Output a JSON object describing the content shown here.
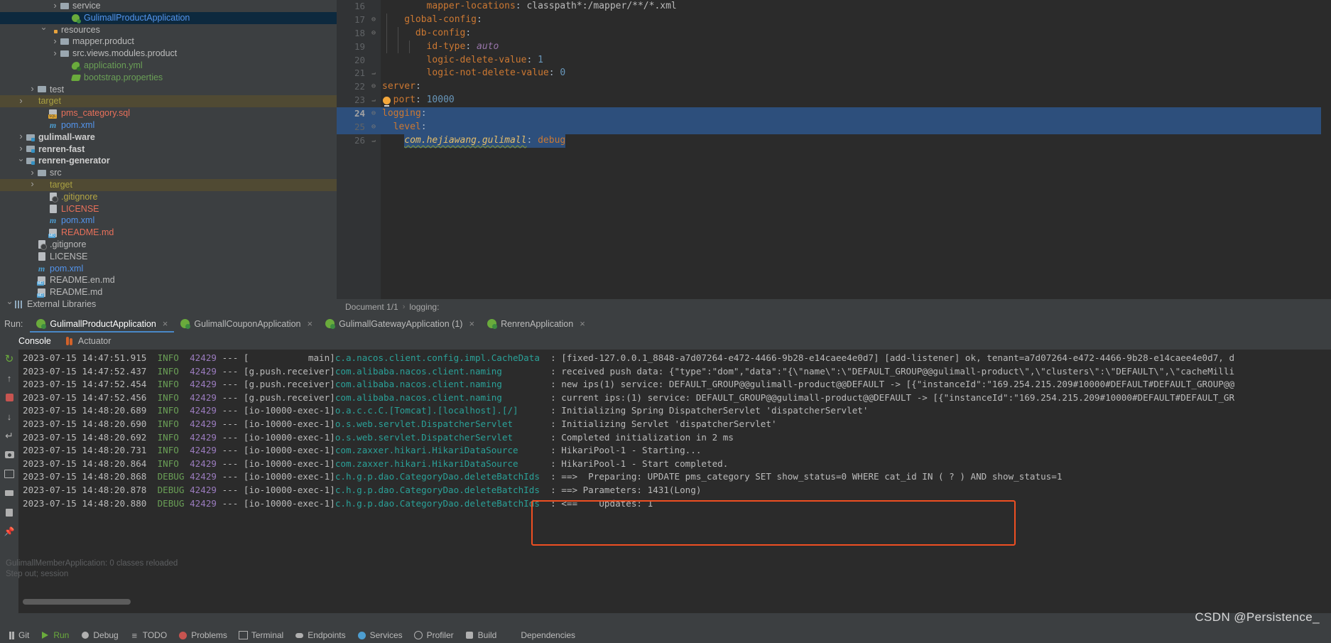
{
  "project_tree": [
    {
      "indent": 4,
      "arrow": "right",
      "icon": "folder",
      "label": "service",
      "color": "c-default",
      "state": "normal"
    },
    {
      "indent": 5,
      "arrow": "none",
      "icon": "spring",
      "label": "GulimallProductApplication",
      "color": "c-sel",
      "state": "selected"
    },
    {
      "indent": 3,
      "arrow": "down",
      "icon": "folder-res",
      "label": "resources",
      "color": "c-default",
      "state": "normal"
    },
    {
      "indent": 4,
      "arrow": "right",
      "icon": "folder",
      "label": "mapper.product",
      "color": "c-default",
      "state": "normal"
    },
    {
      "indent": 4,
      "arrow": "right",
      "icon": "folder",
      "label": "src.views.modules.product",
      "color": "c-default",
      "state": "normal"
    },
    {
      "indent": 5,
      "arrow": "none",
      "icon": "yml",
      "label": "application.yml",
      "color": "c-green",
      "state": "normal"
    },
    {
      "indent": 5,
      "arrow": "none",
      "icon": "props",
      "label": "bootstrap.properties",
      "color": "c-green",
      "state": "normal"
    },
    {
      "indent": 2,
      "arrow": "right",
      "icon": "folder",
      "label": "test",
      "color": "c-default",
      "state": "normal"
    },
    {
      "indent": 1,
      "arrow": "right",
      "icon": "folder-orange",
      "label": "target",
      "color": "c-olive",
      "state": "target"
    },
    {
      "indent": 3,
      "arrow": "none",
      "icon": "sql",
      "label": "pms_category.sql",
      "color": "c-red",
      "state": "normal"
    },
    {
      "indent": 3,
      "arrow": "none",
      "icon": "xml-m",
      "label": "pom.xml",
      "color": "c-blue",
      "state": "normal"
    },
    {
      "indent": 1,
      "arrow": "right",
      "icon": "module",
      "label": "gulimall-ware",
      "color": "bold",
      "state": "normal"
    },
    {
      "indent": 1,
      "arrow": "right",
      "icon": "module",
      "label": "renren-fast",
      "color": "bold",
      "state": "normal"
    },
    {
      "indent": 1,
      "arrow": "down",
      "icon": "module",
      "label": "renren-generator",
      "color": "bold",
      "state": "normal"
    },
    {
      "indent": 2,
      "arrow": "right",
      "icon": "folder",
      "label": "src",
      "color": "c-default",
      "state": "normal"
    },
    {
      "indent": 2,
      "arrow": "right",
      "icon": "folder-orange",
      "label": "target",
      "color": "c-olive",
      "state": "target"
    },
    {
      "indent": 3,
      "arrow": "none",
      "icon": "gitignore",
      "label": ".gitignore",
      "color": "c-yellow",
      "state": "normal"
    },
    {
      "indent": 3,
      "arrow": "none",
      "icon": "license",
      "label": "LICENSE",
      "color": "c-red",
      "state": "normal"
    },
    {
      "indent": 3,
      "arrow": "none",
      "icon": "xml-m",
      "label": "pom.xml",
      "color": "c-blue",
      "state": "normal"
    },
    {
      "indent": 3,
      "arrow": "none",
      "icon": "md",
      "label": "README.md",
      "color": "c-red",
      "state": "normal"
    },
    {
      "indent": 2,
      "arrow": "none",
      "icon": "gitignore",
      "label": ".gitignore",
      "color": "c-default",
      "state": "normal"
    },
    {
      "indent": 2,
      "arrow": "none",
      "icon": "license",
      "label": "LICENSE",
      "color": "c-default",
      "state": "normal"
    },
    {
      "indent": 2,
      "arrow": "none",
      "icon": "xml-m",
      "label": "pom.xml",
      "color": "c-blue",
      "state": "normal"
    },
    {
      "indent": 2,
      "arrow": "none",
      "icon": "md",
      "label": "README.en.md",
      "color": "c-default",
      "state": "normal"
    },
    {
      "indent": 2,
      "arrow": "none",
      "icon": "md",
      "label": "README.md",
      "color": "c-default",
      "state": "normal"
    },
    {
      "indent": 0,
      "arrow": "down",
      "icon": "libs",
      "label": "External Libraries",
      "color": "c-default",
      "state": "normal"
    }
  ],
  "editor": {
    "lines": [
      {
        "num": "16",
        "fold": "",
        "selected": false,
        "indent": 4,
        "tokens": [
          {
            "t": "mapper-locations",
            "c": "k-key"
          },
          {
            "t": ": ",
            "c": "k-plain"
          },
          {
            "t": "classpath*:/mapper/**/*.xml",
            "c": "k-str"
          }
        ]
      },
      {
        "num": "17",
        "fold": "minus",
        "selected": false,
        "indent": 2,
        "tokens": [
          {
            "t": "global-config",
            "c": "k-key"
          },
          {
            "t": ":",
            "c": "k-plain"
          }
        ]
      },
      {
        "num": "18",
        "fold": "minus",
        "selected": false,
        "indent": 3,
        "tokens": [
          {
            "t": "db-config",
            "c": "k-key"
          },
          {
            "t": ":",
            "c": "k-plain"
          }
        ]
      },
      {
        "num": "19",
        "fold": "",
        "selected": false,
        "indent": 4,
        "tokens": [
          {
            "t": "id-type",
            "c": "k-key"
          },
          {
            "t": ": ",
            "c": "k-plain"
          },
          {
            "t": "auto",
            "c": "k-italic"
          }
        ]
      },
      {
        "num": "20",
        "fold": "",
        "selected": false,
        "indent": 4,
        "tokens": [
          {
            "t": "logic-delete-value",
            "c": "k-key"
          },
          {
            "t": ": ",
            "c": "k-plain"
          },
          {
            "t": "1",
            "c": "k-num"
          }
        ]
      },
      {
        "num": "21",
        "fold": "end",
        "selected": false,
        "indent": 4,
        "tokens": [
          {
            "t": "logic-not-delete-value",
            "c": "k-key"
          },
          {
            "t": ": ",
            "c": "k-plain"
          },
          {
            "t": "0",
            "c": "k-num"
          }
        ]
      },
      {
        "num": "22",
        "fold": "minus",
        "selected": false,
        "indent": 0,
        "tokens": [
          {
            "t": "server",
            "c": "k-key"
          },
          {
            "t": ":",
            "c": "k-plain"
          }
        ]
      },
      {
        "num": "23",
        "fold": "end",
        "selected": false,
        "indent": 1,
        "bulb": true,
        "tokens": [
          {
            "t": "port",
            "c": "k-key"
          },
          {
            "t": ": ",
            "c": "k-plain"
          },
          {
            "t": "10000",
            "c": "k-num"
          }
        ]
      },
      {
        "num": "24",
        "fold": "minus",
        "selected": true,
        "current": true,
        "indent": 0,
        "tokens": [
          {
            "t": "logging",
            "c": "k-key"
          },
          {
            "t": ":",
            "c": "k-plain"
          }
        ]
      },
      {
        "num": "25",
        "fold": "minus",
        "selected": true,
        "indent": 1,
        "tokens": [
          {
            "t": "level",
            "c": "k-key"
          },
          {
            "t": ":",
            "c": "k-plain"
          }
        ]
      },
      {
        "num": "26",
        "fold": "end",
        "selected": "partial",
        "indent": 2,
        "tokens": [
          {
            "t": "com.hejiawang.gulimall",
            "c": "k-link"
          },
          {
            "t": ": ",
            "c": "k-plain"
          },
          {
            "t": "debug",
            "c": "k-key"
          }
        ]
      }
    ],
    "breadcrumb": {
      "document": "Document 1/1",
      "separator": "›",
      "node": "logging:"
    }
  },
  "run_window": {
    "run_label": "Run:",
    "tabs": [
      {
        "label": "GulimallProductApplication",
        "active": true,
        "close": "×"
      },
      {
        "label": "GulimallCouponApplication",
        "active": false,
        "close": "×"
      },
      {
        "label": "GulimallGatewayApplication (1)",
        "active": false,
        "close": "×"
      },
      {
        "label": "RenrenApplication",
        "active": false,
        "close": "×"
      }
    ],
    "subtabs": [
      {
        "label": "Console",
        "active": true,
        "icon": "none"
      },
      {
        "label": "Actuator",
        "active": false,
        "icon": "actuator-icon"
      }
    ],
    "toolbar_buttons": [
      "rerun-button",
      "scroll-up-button",
      "scroll-down-button",
      "soft-wrap-button",
      "screenshot-button",
      "layout-button",
      "print-button",
      "clear-all-button",
      "pin-button"
    ]
  },
  "console_lines": [
    {
      "ts": "2023-07-15 14:47:51.915",
      "level": "INFO",
      "pid": "42429",
      "thread": "[           main]",
      "cls": "c.a.nacos.client.config.impl.CacheData",
      "msg": ": [fixed-127.0.0.1_8848-a7d07264-e472-4466-9b28-e14caee4e0d7] [add-listener] ok, tenant=a7d07264-e472-4466-9b28-e14caee4e0d7, d"
    },
    {
      "ts": "2023-07-15 14:47:52.437",
      "level": "INFO",
      "pid": "42429",
      "thread": "[g.push.receiver]",
      "cls": "com.alibaba.nacos.client.naming",
      "msg": ": received push data: {\"type\":\"dom\",\"data\":\"{\\\"name\\\":\\\"DEFAULT_GROUP@@gulimall-product\\\",\\\"clusters\\\":\\\"DEFAULT\\\",\\\"cacheMilli"
    },
    {
      "ts": "2023-07-15 14:47:52.454",
      "level": "INFO",
      "pid": "42429",
      "thread": "[g.push.receiver]",
      "cls": "com.alibaba.nacos.client.naming",
      "msg": ": new ips(1) service: DEFAULT_GROUP@@gulimall-product@@DEFAULT -> [{\"instanceId\":\"169.254.215.209#10000#DEFAULT#DEFAULT_GROUP@@"
    },
    {
      "ts": "2023-07-15 14:47:52.456",
      "level": "INFO",
      "pid": "42429",
      "thread": "[g.push.receiver]",
      "cls": "com.alibaba.nacos.client.naming",
      "msg": ": current ips:(1) service: DEFAULT_GROUP@@gulimall-product@@DEFAULT -> [{\"instanceId\":\"169.254.215.209#10000#DEFAULT#DEFAULT_GR"
    },
    {
      "ts": "2023-07-15 14:48:20.689",
      "level": "INFO",
      "pid": "42429",
      "thread": "[io-10000-exec-1]",
      "cls": "o.a.c.c.C.[Tomcat].[localhost].[/]",
      "msg": ": Initializing Spring DispatcherServlet 'dispatcherServlet'"
    },
    {
      "ts": "2023-07-15 14:48:20.690",
      "level": "INFO",
      "pid": "42429",
      "thread": "[io-10000-exec-1]",
      "cls": "o.s.web.servlet.DispatcherServlet",
      "msg": ": Initializing Servlet 'dispatcherServlet'"
    },
    {
      "ts": "2023-07-15 14:48:20.692",
      "level": "INFO",
      "pid": "42429",
      "thread": "[io-10000-exec-1]",
      "cls": "o.s.web.servlet.DispatcherServlet",
      "msg": ": Completed initialization in 2 ms"
    },
    {
      "ts": "2023-07-15 14:48:20.731",
      "level": "INFO",
      "pid": "42429",
      "thread": "[io-10000-exec-1]",
      "cls": "com.zaxxer.hikari.HikariDataSource",
      "msg": ": HikariPool-1 - Starting..."
    },
    {
      "ts": "2023-07-15 14:48:20.864",
      "level": "INFO",
      "pid": "42429",
      "thread": "[io-10000-exec-1]",
      "cls": "com.zaxxer.hikari.HikariDataSource",
      "msg": ": HikariPool-1 - Start completed."
    },
    {
      "ts": "2023-07-15 14:48:20.868",
      "level": "DEBUG",
      "pid": "42429",
      "thread": "[io-10000-exec-1]",
      "cls": "c.h.g.p.dao.CategoryDao.deleteBatchIds",
      "msg": ": ==>  Preparing: UPDATE pms_category SET show_status=0 WHERE cat_id IN ( ? ) AND show_status=1"
    },
    {
      "ts": "2023-07-15 14:48:20.878",
      "level": "DEBUG",
      "pid": "42429",
      "thread": "[io-10000-exec-1]",
      "cls": "c.h.g.p.dao.CategoryDao.deleteBatchIds",
      "msg": ": ==> Parameters: 1431(Long)"
    },
    {
      "ts": "2023-07-15 14:48:20.880",
      "level": "DEBUG",
      "pid": "42429",
      "thread": "[io-10000-exec-1]",
      "cls": "c.h.g.p.dao.CategoryDao.deleteBatchIds",
      "msg": ": <==    Updates: 1"
    }
  ],
  "overlay": {
    "line1": "GulimallMemberApplication: 0 classes reloaded",
    "line2": "Step out; session"
  },
  "statusbar": {
    "items": [
      {
        "label": "Git",
        "icon": "git-icon"
      },
      {
        "label": "Run",
        "icon": "run-icon",
        "accent": true
      },
      {
        "label": "Debug",
        "icon": "debug-icon"
      },
      {
        "label": "TODO",
        "icon": "todo-icon"
      },
      {
        "label": "Problems",
        "icon": "problems-icon"
      },
      {
        "label": "Terminal",
        "icon": "terminal-icon"
      },
      {
        "label": "Endpoints",
        "icon": "endpoints-icon"
      },
      {
        "label": "Services",
        "icon": "services-icon"
      },
      {
        "label": "Profiler",
        "icon": "profiler-icon"
      },
      {
        "label": "Build",
        "icon": "build-icon"
      },
      {
        "label": "Dependencies",
        "icon": "dependencies-icon"
      }
    ]
  },
  "watermark": "CSDN @Persistence_",
  "colors": {
    "accent_blue": "#4a88c7",
    "selection_blue": "#2d4f7c",
    "tree_selected": "#0d293e",
    "target_highlight": "#504a33",
    "sql_box_border": "#ef4f22",
    "editor_bg": "#2b2b2b",
    "panel_bg": "#3c3f41"
  }
}
